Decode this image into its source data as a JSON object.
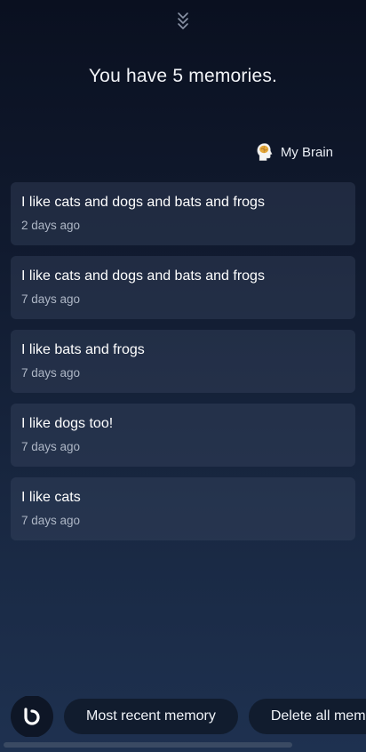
{
  "header": {
    "title": "You have 5 memories.",
    "collapse_icon": "double-chevron-down-icon"
  },
  "brain": {
    "label": "My Brain",
    "icon": "brain-head-icon"
  },
  "memories": [
    {
      "text": "I like cats and dogs and bats and frogs",
      "time": "2 days ago"
    },
    {
      "text": "I like cats and dogs and bats and frogs",
      "time": "7 days ago"
    },
    {
      "text": "I like bats and frogs",
      "time": "7 days ago"
    },
    {
      "text": "I like dogs too!",
      "time": "7 days ago"
    },
    {
      "text": "I like cats",
      "time": "7 days ago"
    }
  ],
  "actions": {
    "assistant_icon": "bixby-icon",
    "most_recent_label": "Most recent memory",
    "delete_all_label": "Delete all memories"
  }
}
